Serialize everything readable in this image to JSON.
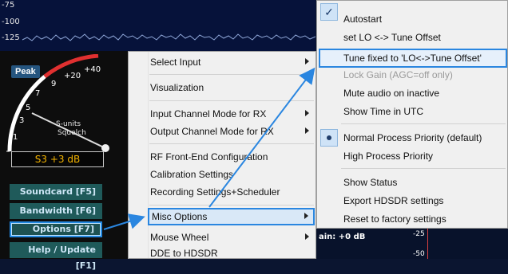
{
  "spectrum": {
    "db_labels": [
      "-75",
      "-100",
      "-125"
    ]
  },
  "smeter": {
    "peak_label": "Peak",
    "scale_labels": [
      "+40",
      "+20",
      "9",
      "7",
      "5",
      "3",
      "1"
    ],
    "s_units_label": "S-units",
    "squelch_label": "Squelch",
    "readout": "S3 +3 dB"
  },
  "left_buttons": {
    "soundcard": "Soundcard [F5]",
    "bandwidth": "Bandwidth [F6]",
    "options": "Options [F7]",
    "help": "Help / Update [F1]"
  },
  "context_menu": {
    "items": [
      "Select Input",
      "Visualization",
      "Input Channel Mode for RX",
      "Output Channel Mode for RX",
      "RF Front-End Configuration",
      "Calibration Settings",
      "Recording Settings+Scheduler",
      "Misc Options",
      "Mouse Wheel",
      "DDE to HDSDR"
    ]
  },
  "submenu": {
    "items": [
      "Autostart",
      "set LO <-> Tune Offset",
      "Tune fixed to 'LO<->Tune Offset'",
      "Lock Gain (AGC=off only)",
      "Mute audio on inactive",
      "Show Time in UTC",
      "Normal Process Priority (default)",
      "High Process Priority",
      "Show Status",
      "Export HDSDR settings",
      "Reset to factory settings"
    ],
    "check_glyph": "✓"
  },
  "bottom": {
    "gain_label": "ain: +0 dB",
    "db_labels": [
      "-25",
      "-50"
    ]
  },
  "colors": {
    "highlight_border": "#2a86e0",
    "button_teal": "#1f5a5a",
    "readout_amber": "#f3b300"
  }
}
